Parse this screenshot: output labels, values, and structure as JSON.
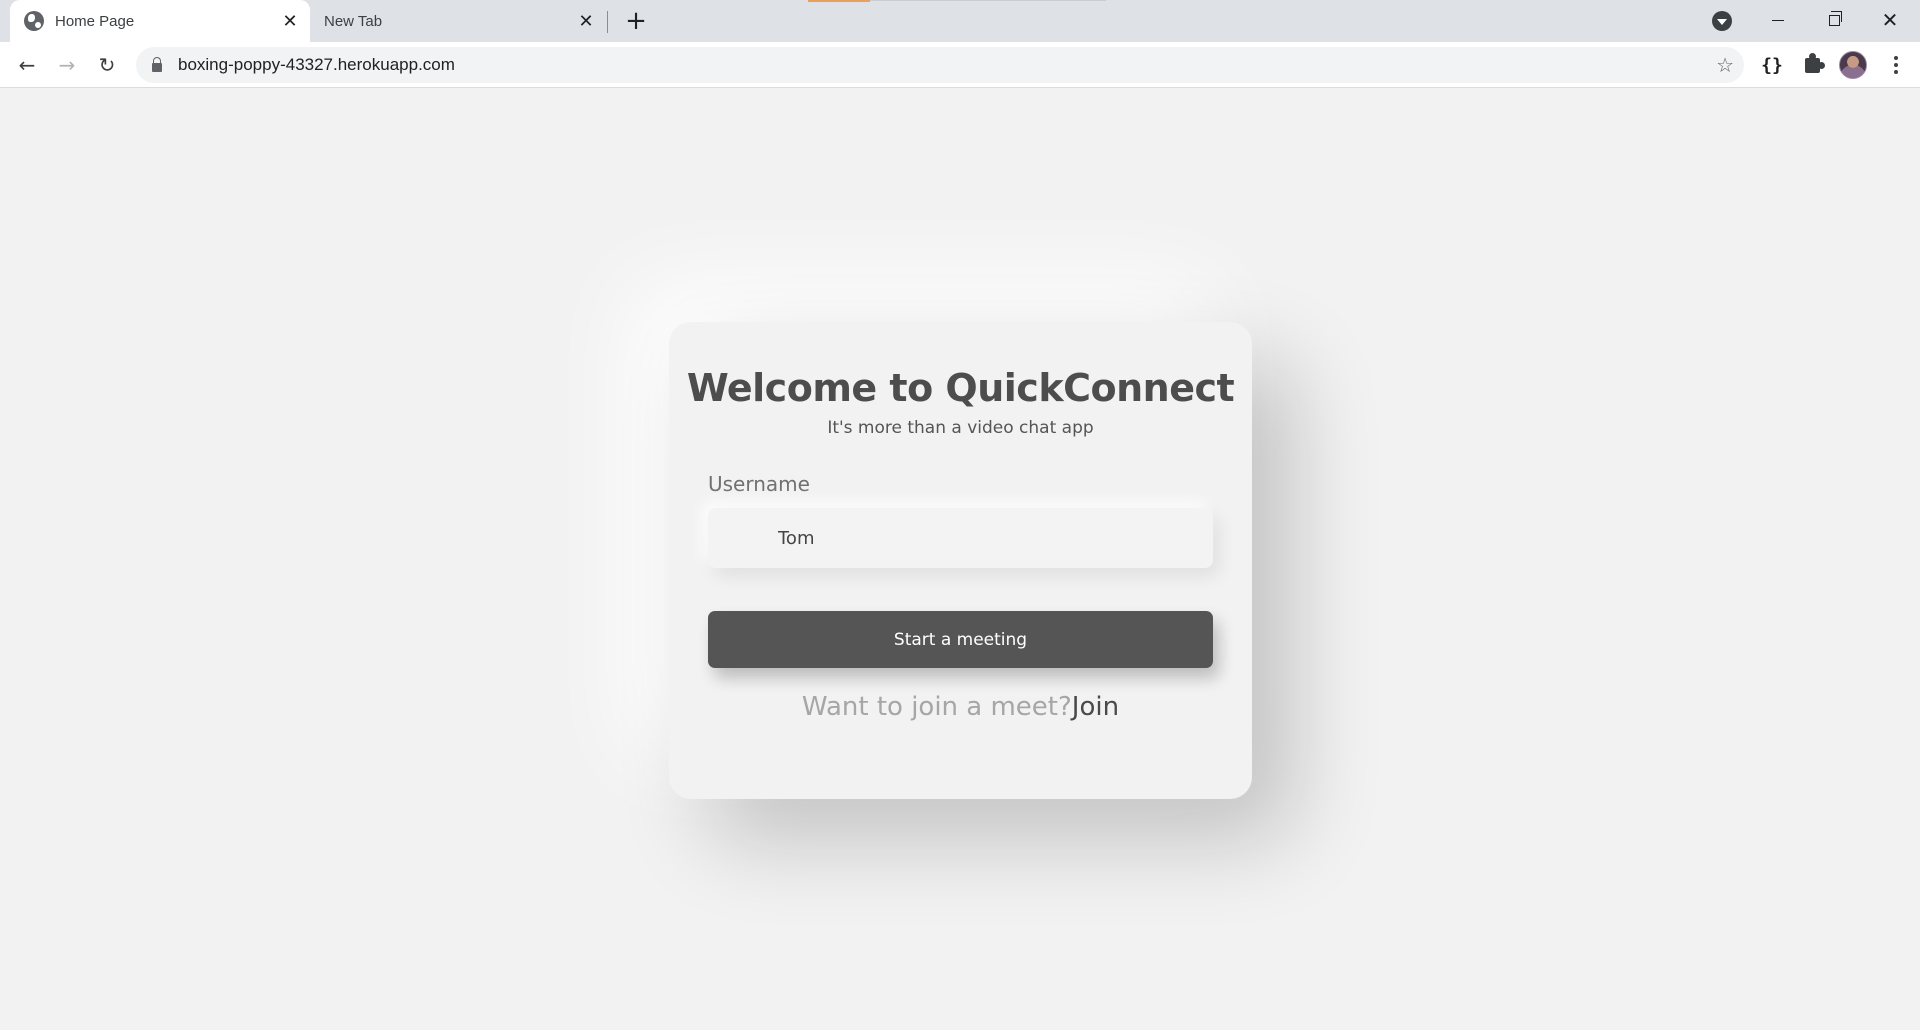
{
  "browser": {
    "tabs": [
      {
        "label": "Home Page",
        "active": true
      },
      {
        "label": "New Tab",
        "active": false
      }
    ],
    "new_tab_symbol": "+",
    "close_symbol": "✕",
    "url": "boxing-poppy-43327.herokuapp.com",
    "nav": {
      "back": "←",
      "forward": "→",
      "reload": "↻"
    },
    "star": "☆",
    "braces": "{}",
    "window_close": "✕"
  },
  "page": {
    "title": "Welcome to QuickConnect",
    "subtitle": "It's more than a video chat app",
    "username_label": "Username",
    "username_value": "Tom",
    "start_button": "Start a meeting",
    "join_prompt": "Want to join a meet?",
    "join_link": "Join"
  }
}
